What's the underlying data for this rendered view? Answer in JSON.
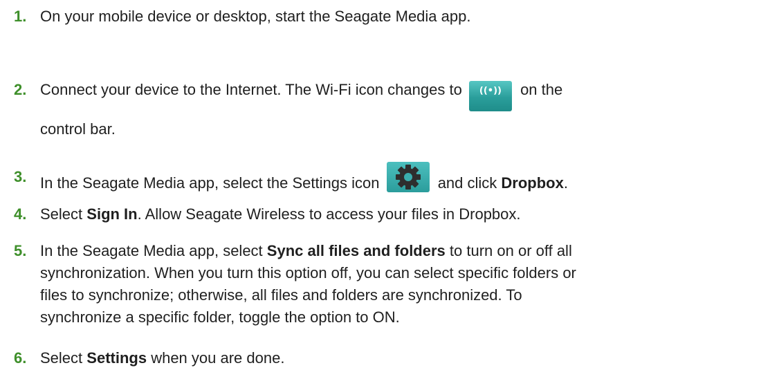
{
  "steps": [
    {
      "number": "1.",
      "parts": [
        "On your mobile device or desktop, start the Seagate Media app."
      ]
    },
    {
      "number": "2.",
      "parts": [
        "Connect your device to the Internet. The Wi-Fi icon changes to",
        "on the",
        "control bar."
      ],
      "icon": "wifi-connected-icon",
      "icon_text": "((•))"
    },
    {
      "number": "3.",
      "parts": [
        "In the Seagate Media app, select the Settings icon",
        "and click",
        "Dropbox",
        "."
      ],
      "icon": "gear-icon"
    },
    {
      "number": "4.",
      "parts": [
        "Select",
        "Sign In",
        ". Allow Seagate Wireless to access your files in Dropbox."
      ]
    },
    {
      "number": "5.",
      "parts": [
        "In the Seagate Media app, select",
        "Sync all files and folders",
        "to turn on or off all",
        "synchronization. When you turn this option off, you can select specific folders or",
        "files to synchronize; otherwise, all files and folders are synchronized. To",
        "synchronize a specific folder, toggle the option to ON."
      ]
    },
    {
      "number": "6.",
      "parts": [
        "Select",
        "Settings",
        "when you are done."
      ]
    }
  ],
  "colors": {
    "step_number": "#3e8f2a",
    "icon_teal": "#2a9e9b",
    "body_text": "#1f1f1f"
  }
}
